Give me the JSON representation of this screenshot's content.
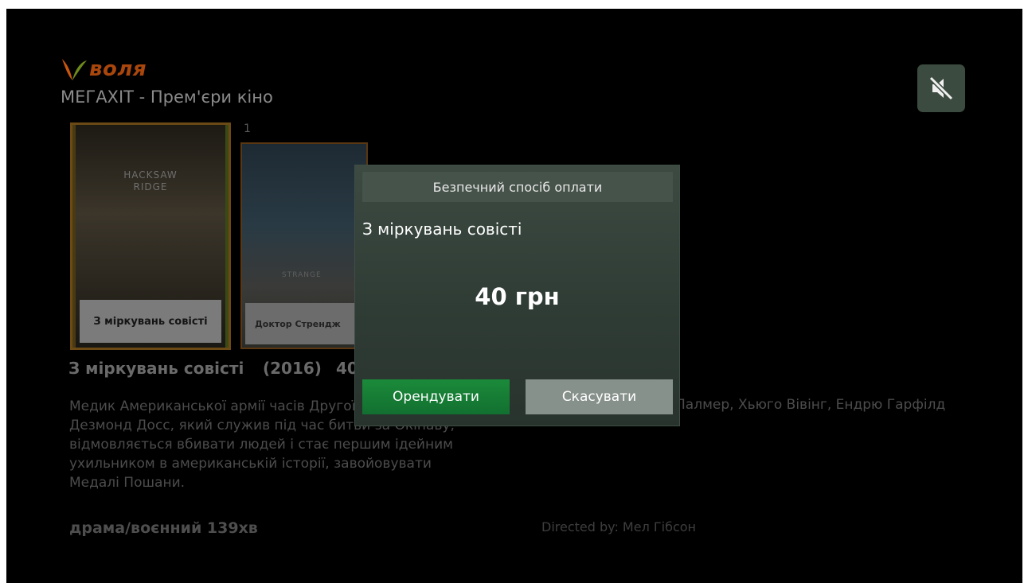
{
  "brand": {
    "name": "воля",
    "colors": {
      "orange": "#c8560f",
      "green": "#6e8a1a"
    }
  },
  "category": {
    "title": "МЕГАХІТ - Прем'єри кіно"
  },
  "mute_button": {
    "icon": "speaker-mute-icon"
  },
  "carousel": {
    "selected": {
      "art_text_line1": "HACKSAW",
      "art_text_line2": "RIDGE",
      "caption": "З міркувань совісті"
    },
    "second": {
      "index": "1",
      "art_text": "STRANGE",
      "caption": "Доктор Стрендж"
    }
  },
  "movie": {
    "title": "З міркувань совісті",
    "year": "(2016)",
    "price_partial": "40",
    "description": "Медик Американської армії часів Другої світової війни Дезмонд Досс, який служив під час битви за Окінаву, відмовляється вбивати людей і стає першим ідейним ухильником в американській історії, завойовувати Медалі Пошани.",
    "cast": "Палмер, Хьюго Вівінг, Ендрю Гарфілд",
    "genre": "драма/воєнний  139хв",
    "director": "Directed by: Мел Гібсон"
  },
  "dialog": {
    "header": "Безпечний спосіб оплати",
    "movie_title": "З міркувань совісті",
    "price": "40 грн",
    "rent_label": "Орендувати",
    "cancel_label": "Скасувати"
  }
}
